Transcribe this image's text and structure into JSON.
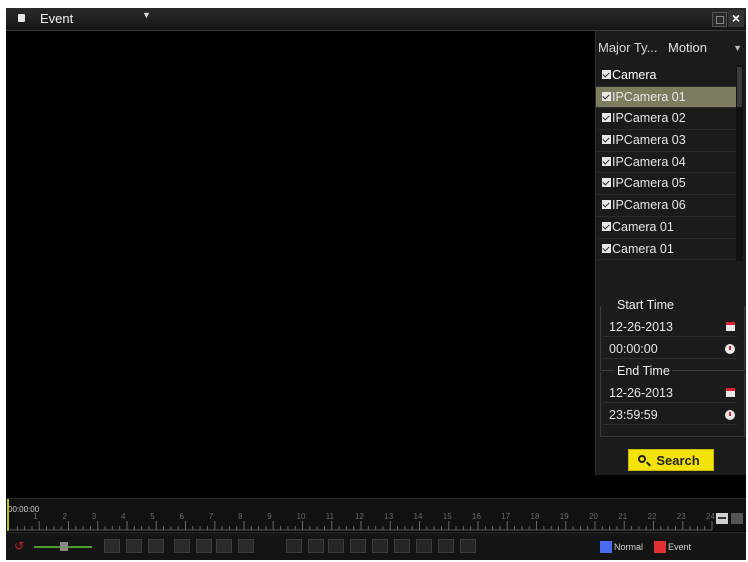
{
  "titlebar": {
    "title": "Event"
  },
  "panel": {
    "major_type_label": "Major Ty...",
    "major_type_value": "Motion",
    "camera_header": "Camera",
    "cameras": [
      "IPCamera 01",
      "IPCamera 02",
      "IPCamera 03",
      "IPCamera 04",
      "IPCamera 05",
      "IPCamera 06",
      "Camera 01",
      "Camera 01"
    ],
    "selected_camera_index": 0,
    "start_time": {
      "label": "Start Time",
      "date": "12-26-2013",
      "time": "00:00:00"
    },
    "end_time": {
      "label": "End Time",
      "date": "12-26-2013",
      "time": "23:59:59"
    },
    "search_label": "Search"
  },
  "timeline": {
    "readout": "00:00:00",
    "hour_labels": [
      "1",
      "2",
      "3",
      "4",
      "5",
      "6",
      "7",
      "8",
      "9",
      "10",
      "11",
      "12",
      "13",
      "14",
      "15",
      "16",
      "17",
      "18",
      "19",
      "20",
      "21",
      "22",
      "23",
      "24"
    ]
  },
  "legend": {
    "normal": {
      "label": "Normal",
      "color": "#4a6cf0"
    },
    "event": {
      "label": "Event",
      "color": "#e03030"
    }
  }
}
